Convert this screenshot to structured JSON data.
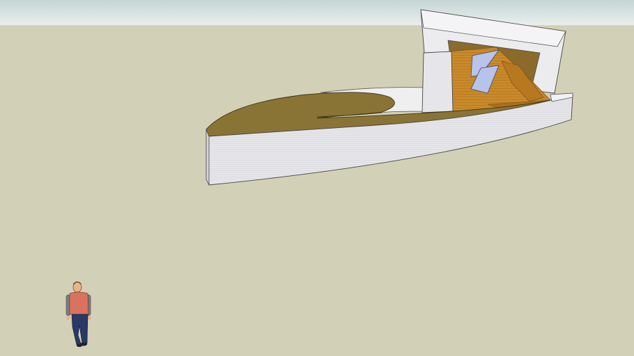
{
  "scene": {
    "type": "3d-model-viewport",
    "colors": {
      "sky_top": "#c5d6d4",
      "sky_bottom": "#e8eeec",
      "ground": "#d3d0b8",
      "wall_white": "#e8e8ec",
      "wall_shadow": "#cfcfd6",
      "roof_olive": "#8a7435",
      "wood_orange": "#c8862a",
      "glass_blue": "#b7c3ea",
      "person_shirt": "#d9735e",
      "person_pants": "#2a3a66"
    },
    "objects": [
      "curved-wall",
      "curved-roof",
      "tower-frame",
      "wood-interior",
      "glass-panel",
      "scale-figure"
    ]
  }
}
